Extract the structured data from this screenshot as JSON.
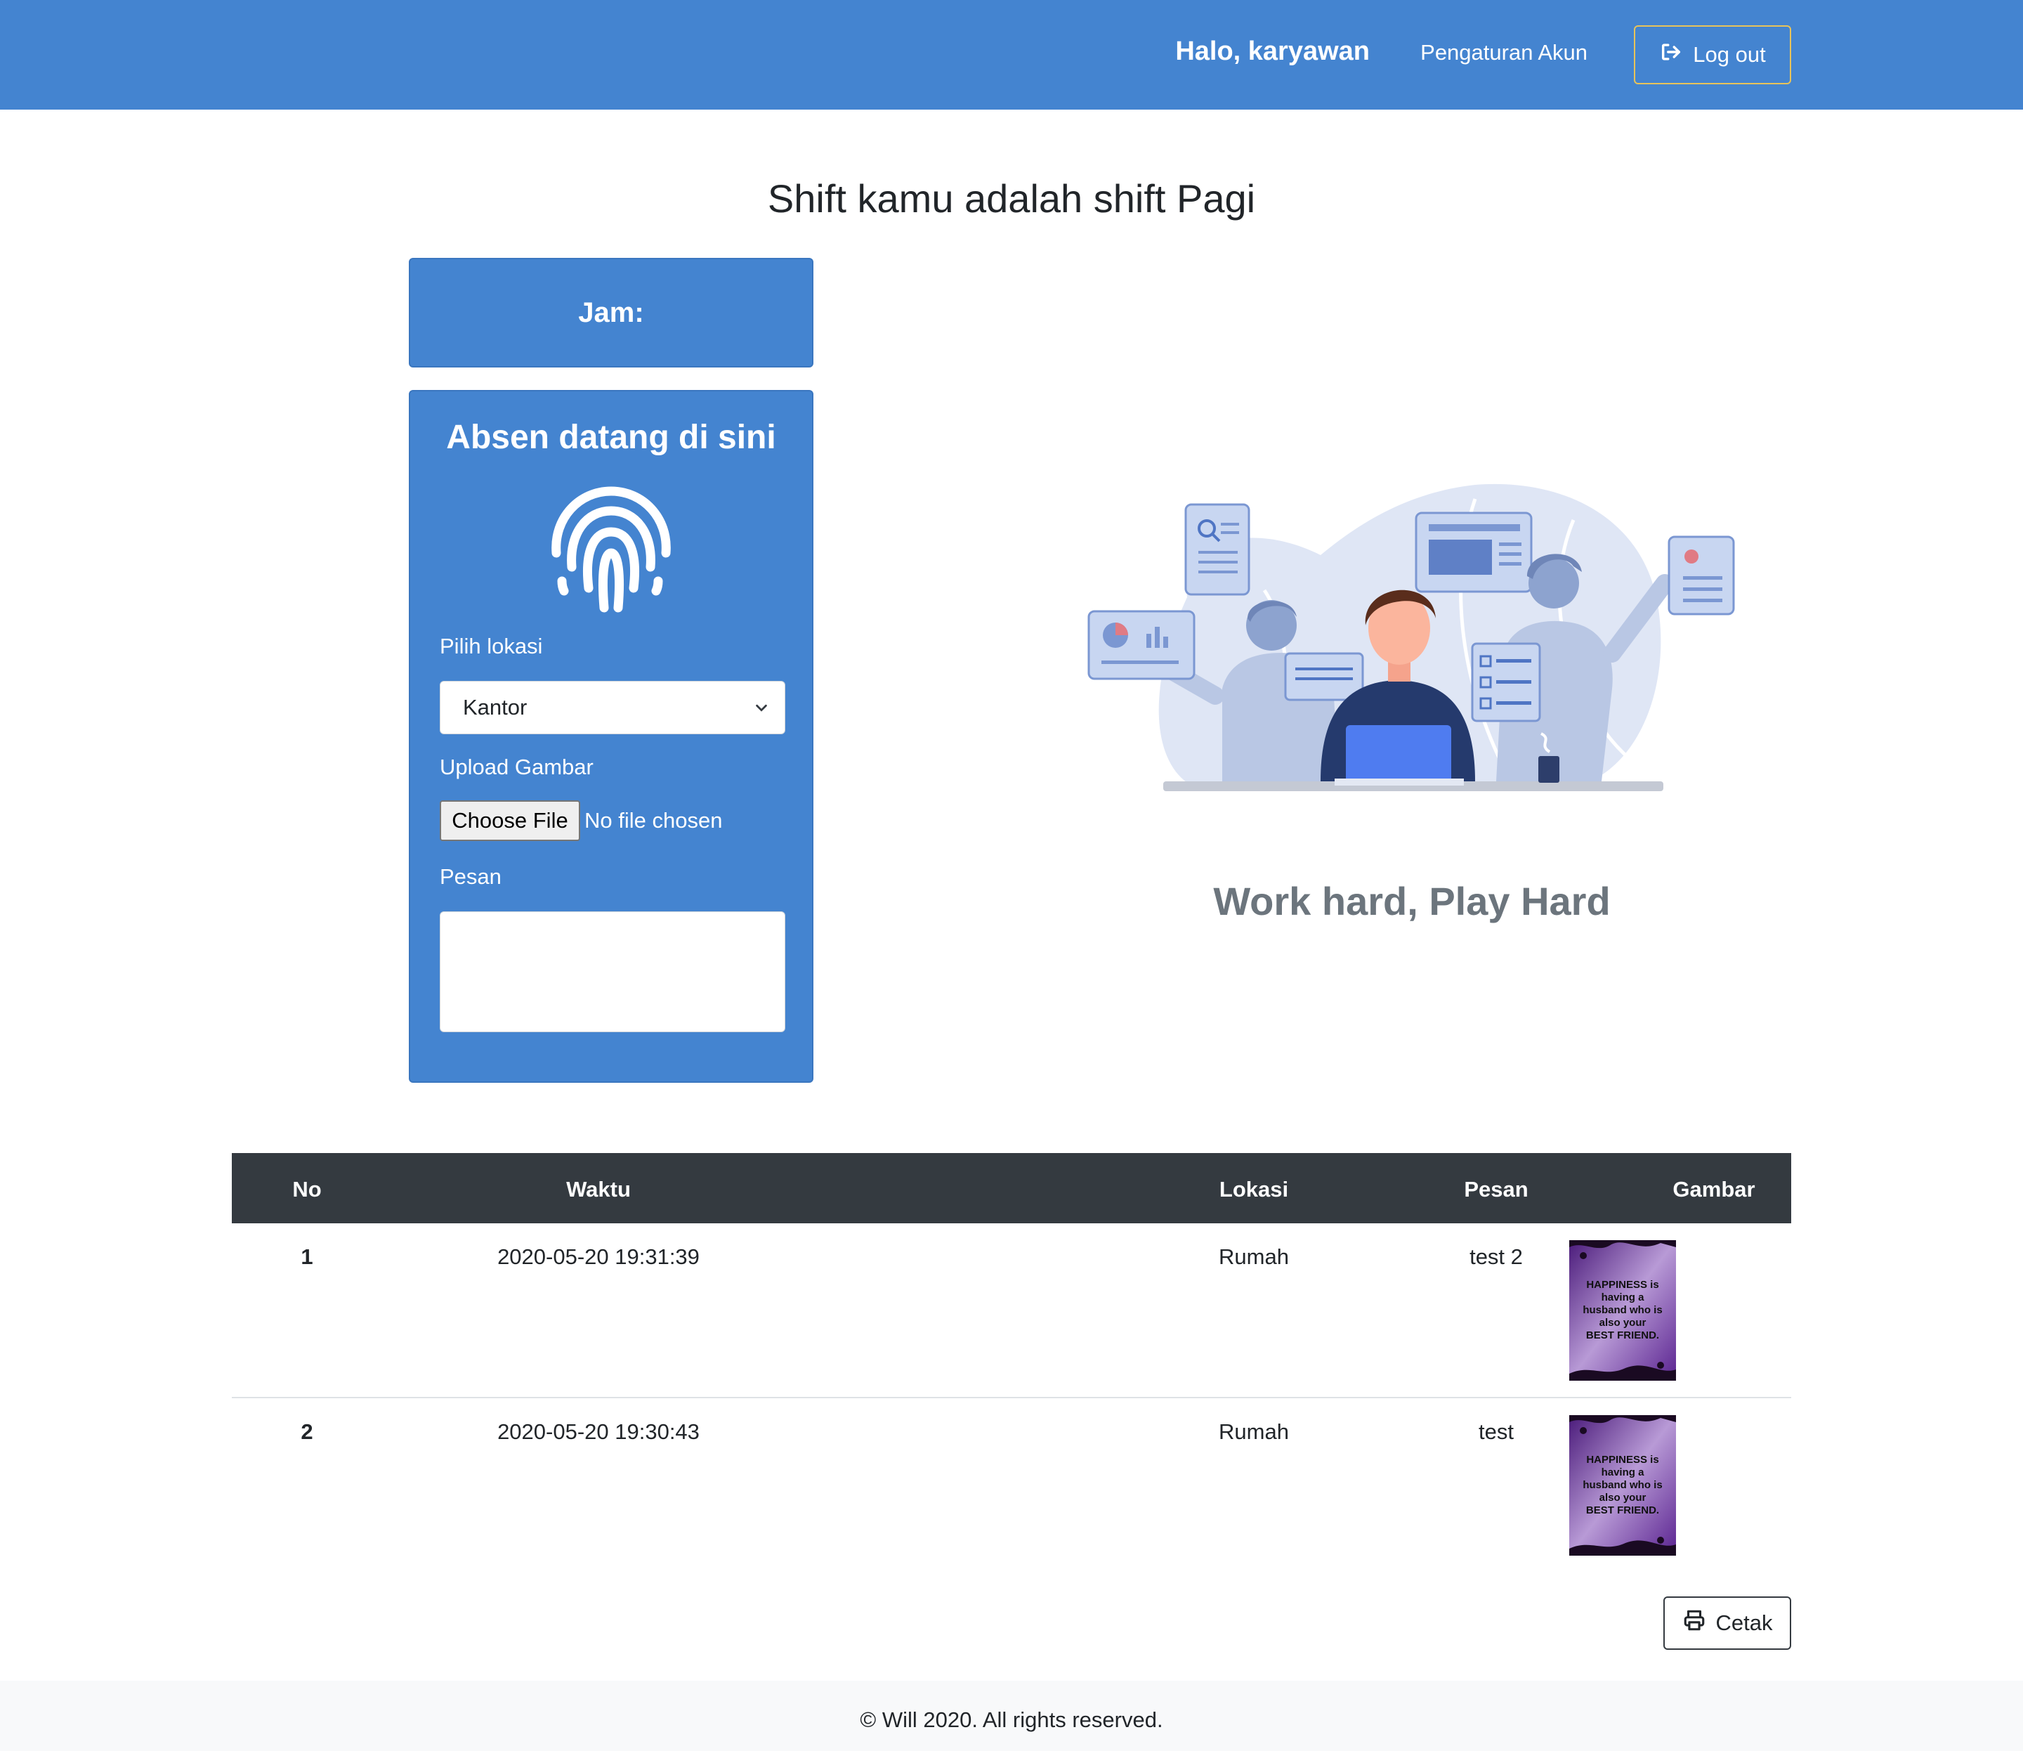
{
  "navbar": {
    "greeting": "Halo, karyawan",
    "settings_label": "Pengaturan Akun",
    "logout_label": "Log out"
  },
  "main": {
    "title": "Shift kamu adalah shift Pagi",
    "jam_label": "Jam:",
    "absen_card": {
      "title": "Absen datang di sini",
      "location_label": "Pilih lokasi",
      "location_selected": "Kantor",
      "upload_label": "Upload Gambar",
      "file_button": "Choose File",
      "file_status": "No file chosen",
      "message_label": "Pesan",
      "message_value": ""
    },
    "tagline": "Work hard, Play Hard"
  },
  "table": {
    "headers": [
      "No",
      "Waktu",
      "Lokasi",
      "Pesan",
      "Gambar"
    ],
    "rows": [
      {
        "no": "1",
        "waktu": "2020-05-20 19:31:39",
        "lokasi": "Rumah",
        "pesan": "test 2",
        "image_text": [
          "HAPPINESS is",
          "having a",
          "husband who is",
          "also your",
          "BEST FRIEND."
        ]
      },
      {
        "no": "2",
        "waktu": "2020-05-20 19:30:43",
        "lokasi": "Rumah",
        "pesan": "test",
        "image_text": [
          "HAPPINESS is",
          "having a",
          "husband who is",
          "also your",
          "BEST FRIEND."
        ]
      }
    ]
  },
  "print_label": "Cetak",
  "footer": {
    "text": "© Will 2020. All rights reserved."
  },
  "colors": {
    "primary": "#4484d0",
    "dark": "#343a40",
    "logout_border": "#e8c35a",
    "tagline": "#6c757d"
  },
  "icons": {
    "logout": "sign-out-icon",
    "print": "printer-icon",
    "fingerprint": "fingerprint-icon"
  }
}
